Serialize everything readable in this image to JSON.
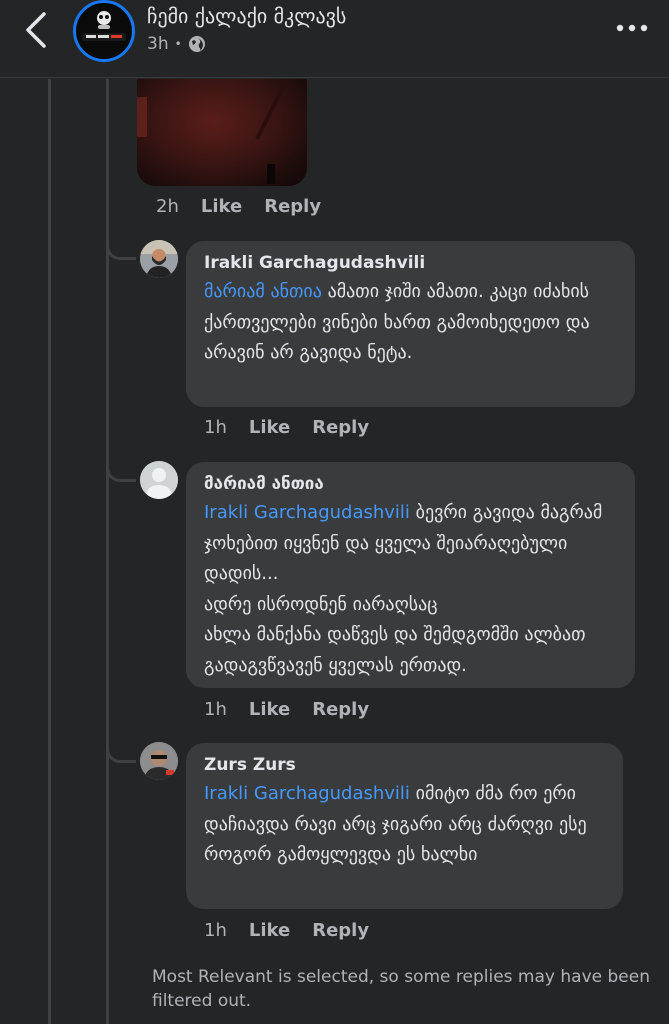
{
  "header": {
    "group_name": "ჩემი ქალაქი მკლავს",
    "time": "3h",
    "avatar_logo_text": "ჩემი ქალაქი მკლავს",
    "back_icon": "chevron-left-icon",
    "privacy_icon": "globe-icon",
    "more_icon": "ellipsis-icon"
  },
  "first_comment_actions": {
    "time": "2h",
    "like": "Like",
    "reply": "Reply"
  },
  "replies": [
    {
      "author": "Irakli Garchagudashvili",
      "mention": "მარიამ ანთია",
      "text": " ამათი ჯიში ამათი. კაცი იძახის ქართველები ვინები ხართ გამოიხედეთო და არავინ არ გავიდა ნეტა.",
      "time": "1h",
      "like": "Like",
      "reply": "Reply"
    },
    {
      "author": "მარიამ ანთია",
      "mention": "Irakli Garchagudashvili",
      "text": " ბევრი გავიდა მაგრამ ჯოხებით იყვნენ და ყველა შეიარაღებული დადის...\nადრე ისროდნენ იარაღსაც\nახლა მანქანა დაწვეს და შემდგომში ალბათ გადაგვწვავენ ყველას ერთად.",
      "time": "1h",
      "like": "Like",
      "reply": "Reply"
    },
    {
      "author": "Zurs Zurs",
      "mention": "Irakli Garchagudashvili",
      "text": " იმიტო ძმა რო ერი დაჩიავდა  რავი არც ჯიგარი არც ძარღვი ესე როგორ გამოყლევდა ეს ხალხი",
      "time": "1h",
      "like": "Like",
      "reply": "Reply"
    }
  ],
  "footer_note": "Most Relevant is selected, so some replies may have been filtered out.",
  "colors": {
    "background": "#242526",
    "bubble": "#3a3b3c",
    "mention": "#4599ff",
    "secondary_text": "#b0b3b8"
  }
}
